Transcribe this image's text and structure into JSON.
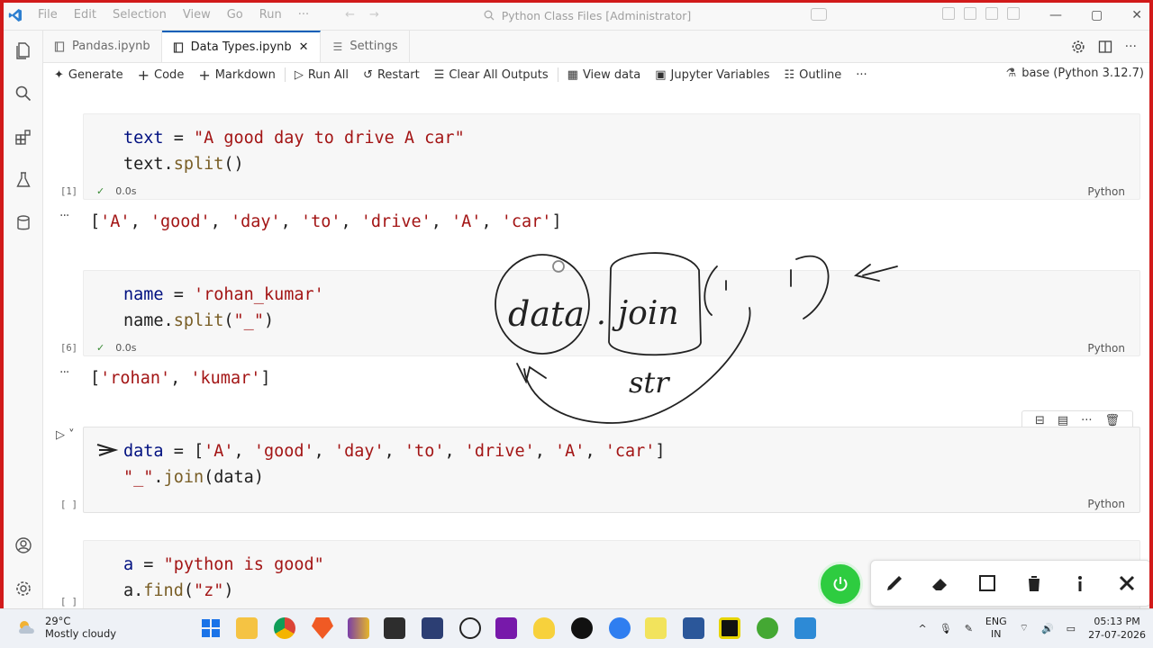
{
  "window": {
    "menu": [
      "File",
      "Edit",
      "Selection",
      "View",
      "Go",
      "Run",
      "···"
    ],
    "search_text": "Python Class Files [Administrator]",
    "controls": [
      "—",
      "▢",
      "✕"
    ]
  },
  "tabs": [
    {
      "label": "Pandas.ipynb",
      "active": false
    },
    {
      "label": "Data Types.ipynb",
      "active": true,
      "close": "✕"
    },
    {
      "label": "Settings",
      "active": false
    }
  ],
  "toolbar": {
    "generate": "Generate",
    "code": "Code",
    "markdown": "Markdown",
    "run_all": "Run All",
    "restart": "Restart",
    "clear_outputs": "Clear All Outputs",
    "view_data": "View data",
    "jupyter_variables": "Jupyter Variables",
    "outline": "Outline",
    "more": "···",
    "kernel": "base (Python 3.12.7)"
  },
  "cells": [
    {
      "exec": "[1]",
      "lines": [
        "text = \"A good day to drive A car\"",
        "text.split()"
      ],
      "timing": "0.0s",
      "lang": "Python",
      "output": "['A', 'good', 'day', 'to', 'drive', 'A', 'car']"
    },
    {
      "exec": "[6]",
      "lines": [
        "name = 'rohan_kumar'",
        "name.split(\"_\")"
      ],
      "timing": "0.0s",
      "lang": "Python",
      "output": "['rohan', 'kumar']"
    },
    {
      "exec": "[ ]",
      "lines": [
        "data = ['A', 'good', 'day', 'to', 'drive', 'A', 'car']",
        "\"_\".join(data)"
      ],
      "lang": "Python"
    },
    {
      "exec": "[ ]",
      "lines": [
        "a = \"python is good\"",
        "a.find(\"z\")"
      ]
    }
  ],
  "output_marker": "···",
  "annotation_text": {
    "word1": "data",
    "word2": "join",
    "word3": "str"
  },
  "taskbar": {
    "temp": "29°C",
    "weather": "Mostly cloudy",
    "lang_line1": "ENG",
    "lang_line2": "IN",
    "time": "05:13 PM",
    "date": "27-07-2026"
  },
  "colors": {
    "accent": "#005fb8",
    "string": "#a31515",
    "variable": "#001080",
    "power": "#2ecc40",
    "frame": "#d11a1a"
  }
}
